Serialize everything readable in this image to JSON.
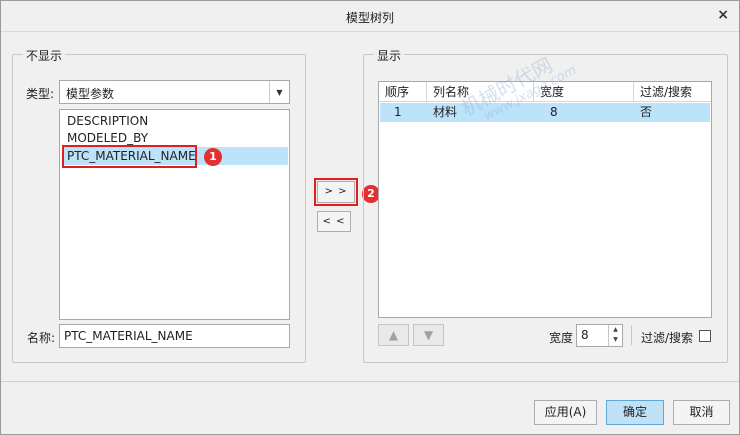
{
  "window": {
    "title": "模型树列",
    "close_glyph": "×"
  },
  "left": {
    "group_label": "不显示",
    "type_label": "类型:",
    "type_value": "模型参数",
    "list_items": [
      "DESCRIPTION",
      "MODELED_BY",
      "PTC_MATERIAL_NAME"
    ],
    "selected_index": 2,
    "name_label": "名称:",
    "name_value": "PTC_MATERIAL_NAME"
  },
  "middle": {
    "add_label": "> >",
    "remove_label": "< <"
  },
  "right": {
    "group_label": "显示",
    "columns": [
      "顺序",
      "列名称",
      "宽度",
      "过滤/搜索"
    ],
    "rows": [
      {
        "order": "1",
        "name": "材料",
        "width": "8",
        "filter": "否"
      }
    ],
    "width_label": "宽度",
    "width_value": "8",
    "filter_label": "过滤/搜索",
    "filter_checked": false
  },
  "annotations": {
    "marker1": "1",
    "marker2": "2"
  },
  "watermark": {
    "text": "机械时代网",
    "url": "www.jxage.com"
  },
  "footer": {
    "apply_label": "应用(A)",
    "ok_label": "确定",
    "cancel_label": "取消"
  },
  "colors": {
    "selection": "#bde3fb",
    "marker_red": "#e53030",
    "primary_button": "#bfe2f7"
  }
}
